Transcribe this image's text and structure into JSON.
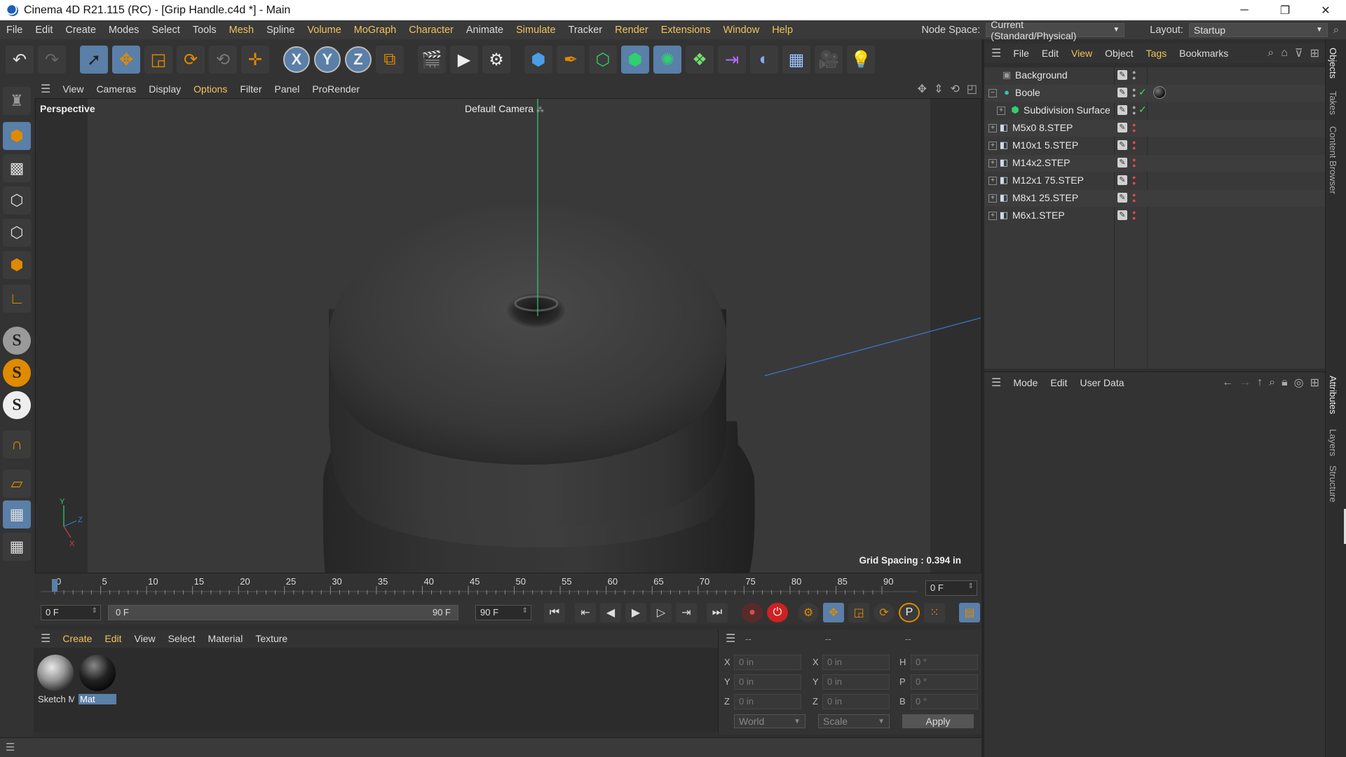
{
  "window": {
    "title": "Cinema 4D R21.115 (RC) - [Grip Handle.c4d *] - Main",
    "controls": [
      "minimize",
      "restore",
      "close"
    ]
  },
  "menubar": {
    "items": [
      "File",
      "Edit",
      "Create",
      "Modes",
      "Select",
      "Tools",
      "Mesh",
      "Spline",
      "Volume",
      "MoGraph",
      "Character",
      "Animate",
      "Simulate",
      "Tracker",
      "Render",
      "Extensions",
      "Window",
      "Help"
    ],
    "node_space_label": "Node Space:",
    "node_space_value": "Current (Standard/Physical)",
    "layout_label": "Layout:",
    "layout_value": "Startup"
  },
  "viewport": {
    "menu": [
      "View",
      "Cameras",
      "Display",
      "Options",
      "Filter",
      "Panel",
      "ProRender"
    ],
    "label": "Perspective",
    "camera": "Default Camera",
    "grid_spacing": "Grid Spacing : 0.394 in",
    "axis": {
      "y": "Y",
      "z": "Z",
      "x": "X"
    }
  },
  "timeline": {
    "ticks": [
      "0",
      "5",
      "10",
      "15",
      "20",
      "25",
      "30",
      "35",
      "40",
      "45",
      "50",
      "55",
      "60",
      "65",
      "70",
      "75",
      "80",
      "85",
      "90"
    ],
    "current_frame": "0 F"
  },
  "transport": {
    "start_field": "0 F",
    "range_start": "0 F",
    "range_end": "90 F",
    "end_field": "90 F"
  },
  "material_manager": {
    "menu": [
      "Create",
      "Edit",
      "View",
      "Select",
      "Material",
      "Texture"
    ],
    "materials": [
      {
        "name": "Sketch M",
        "selected": false
      },
      {
        "name": "Mat",
        "selected": true
      }
    ]
  },
  "coordinates": {
    "headers": [
      "--",
      "--",
      "--"
    ],
    "rows": [
      {
        "a": "X",
        "a_val": "0 in",
        "b": "X",
        "b_val": "0 in",
        "c": "H",
        "c_val": "0 °"
      },
      {
        "a": "Y",
        "a_val": "0 in",
        "b": "Y",
        "b_val": "0 in",
        "c": "P",
        "c_val": "0 °"
      },
      {
        "a": "Z",
        "a_val": "0 in",
        "b": "Z",
        "b_val": "0 in",
        "c": "B",
        "c_val": "0 °"
      }
    ],
    "space": "World",
    "mode": "Scale",
    "apply": "Apply"
  },
  "object_manager": {
    "menu": [
      "File",
      "Edit",
      "View",
      "Object",
      "Tags",
      "Bookmarks"
    ],
    "objects": [
      {
        "name": "Background",
        "indent": 0,
        "expand": "",
        "icon": "background",
        "check": false,
        "tag": false
      },
      {
        "name": "Boole",
        "indent": 0,
        "expand": "−",
        "icon": "boole",
        "check": true,
        "tag": true
      },
      {
        "name": "Subdivision Surface",
        "indent": 1,
        "expand": "+",
        "icon": "subdivision",
        "check": true,
        "tag": false
      },
      {
        "name": "M5x0 8.STEP",
        "indent": 0,
        "expand": "+",
        "icon": "null",
        "check": false,
        "tag": false
      },
      {
        "name": "M10x1 5.STEP",
        "indent": 0,
        "expand": "+",
        "icon": "null",
        "check": false,
        "tag": false
      },
      {
        "name": "M14x2.STEP",
        "indent": 0,
        "expand": "+",
        "icon": "null",
        "check": false,
        "tag": false
      },
      {
        "name": "M12x1 75.STEP",
        "indent": 0,
        "expand": "+",
        "icon": "null",
        "check": false,
        "tag": false
      },
      {
        "name": "M8x1 25.STEP",
        "indent": 0,
        "expand": "+",
        "icon": "null",
        "check": false,
        "tag": false
      },
      {
        "name": "M6x1.STEP",
        "indent": 0,
        "expand": "+",
        "icon": "null",
        "check": false,
        "tag": false
      }
    ]
  },
  "attributes": {
    "menu": [
      "Mode",
      "Edit",
      "User Data"
    ]
  },
  "side_tabs": [
    "Objects",
    "Takes",
    "Content Browser",
    "Attributes",
    "Layers",
    "Structure"
  ],
  "colors": {
    "accent": "#f2c25c",
    "selection": "#5a7fa8",
    "icon_orange": "#e08a00"
  }
}
